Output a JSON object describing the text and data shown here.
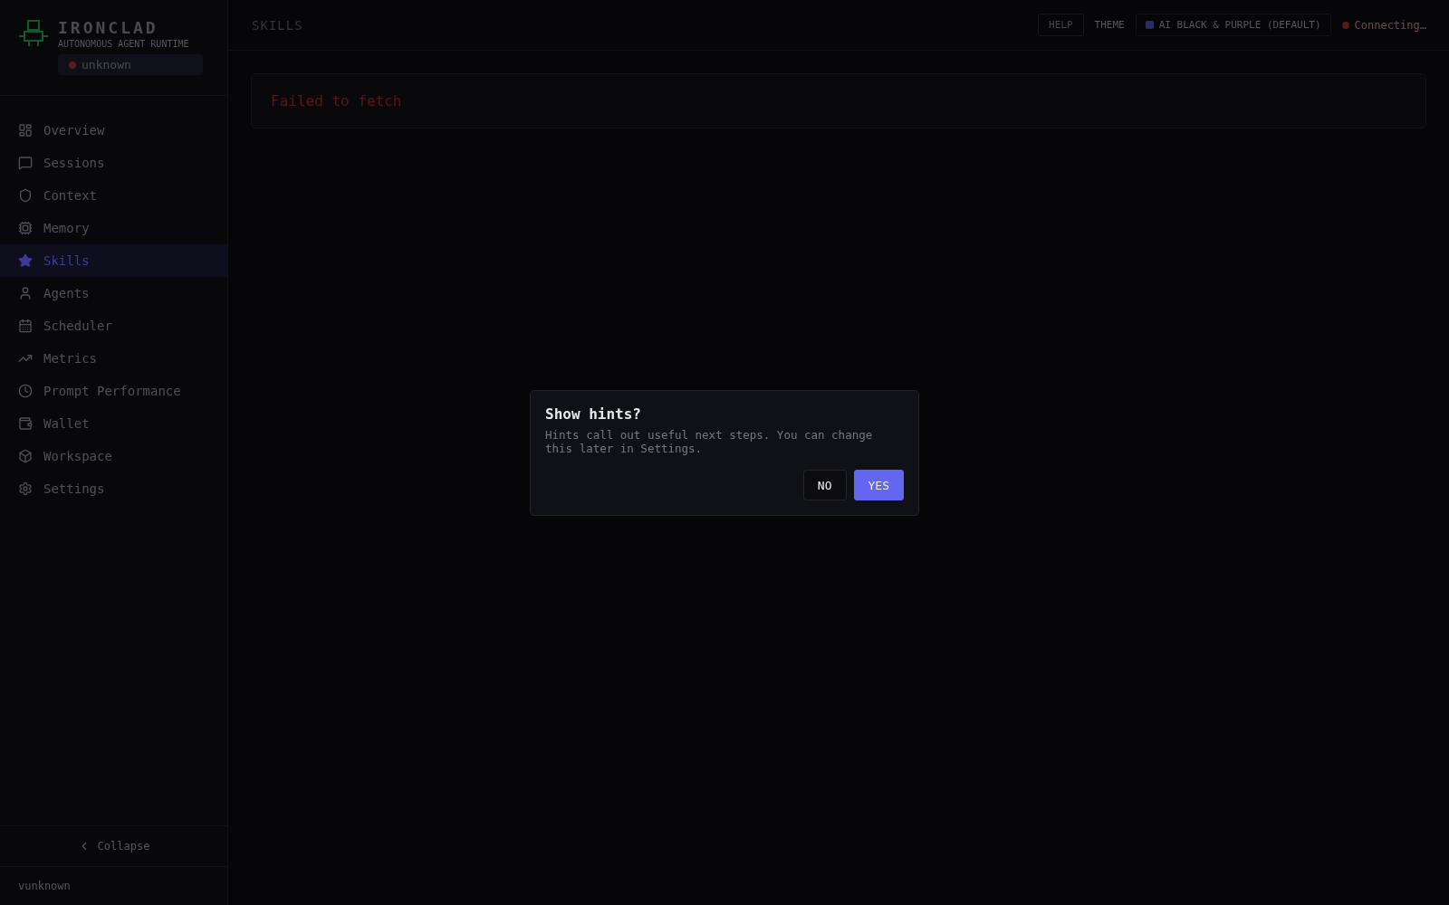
{
  "brand": {
    "name": "IRONCLAD",
    "tagline": "AUTONOMOUS AGENT RUNTIME",
    "status": "unknown"
  },
  "sidebar": {
    "items": [
      {
        "label": "Overview",
        "selected": false
      },
      {
        "label": "Sessions",
        "selected": false
      },
      {
        "label": "Context",
        "selected": false
      },
      {
        "label": "Memory",
        "selected": false
      },
      {
        "label": "Skills",
        "selected": true
      },
      {
        "label": "Agents",
        "selected": false
      },
      {
        "label": "Scheduler",
        "selected": false
      },
      {
        "label": "Metrics",
        "selected": false
      },
      {
        "label": "Prompt Performance",
        "selected": false
      },
      {
        "label": "Wallet",
        "selected": false
      },
      {
        "label": "Workspace",
        "selected": false
      },
      {
        "label": "Settings",
        "selected": false
      }
    ],
    "collapse": "Collapse",
    "version": "vunknown"
  },
  "header": {
    "title": "SKILLS",
    "help": "HELP",
    "theme_label": "THEME",
    "theme": "AI BLACK & PURPLE (DEFAULT)",
    "connection": "Connecting…"
  },
  "error": "Failed to fetch",
  "dialog": {
    "title": "Show hints?",
    "body": "Hints call out useful next steps. You can change this later in Settings.",
    "buttons": [
      {
        "label": "NO",
        "kind": "secondary"
      },
      {
        "label": "YES",
        "kind": "primary"
      }
    ]
  }
}
